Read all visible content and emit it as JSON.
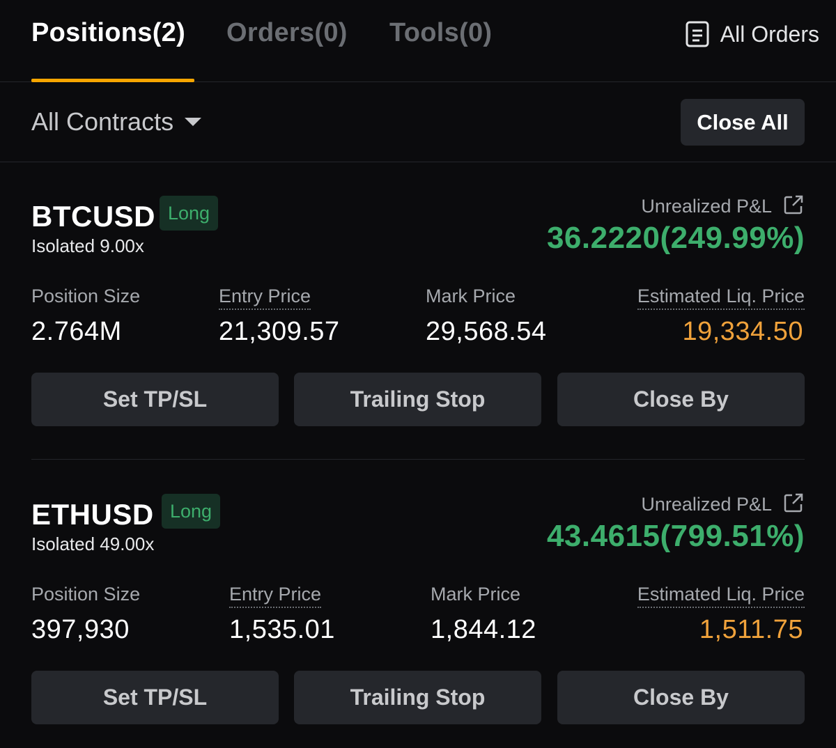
{
  "tabs": [
    {
      "label": "Positions(2)",
      "active": true
    },
    {
      "label": "Orders(0)",
      "active": false
    },
    {
      "label": "Tools(0)",
      "active": false
    }
  ],
  "all_orders": {
    "label": "All Orders",
    "icon": "document-icon"
  },
  "filter": {
    "label": "All Contracts",
    "icon": "caret-down-icon"
  },
  "close_all_label": "Close All",
  "positions": [
    {
      "symbol": "BTCUSD",
      "side": "Long",
      "leverage": "Isolated 9.00x",
      "pnl_label": "Unrealized P&L",
      "pnl_value": "36.2220(249.99%)",
      "stats": {
        "size_label": "Position Size",
        "size_value": "2.764M",
        "entry_label": "Entry Price",
        "entry_value": "21,309.57",
        "mark_label": "Mark Price",
        "mark_value": "29,568.54",
        "liq_label": "Estimated Liq. Price",
        "liq_value": "19,334.50"
      },
      "buttons": {
        "tpsl": "Set TP/SL",
        "trailing": "Trailing Stop",
        "close_by": "Close By"
      }
    },
    {
      "symbol": "ETHUSD",
      "side": "Long",
      "leverage": "Isolated 49.00x",
      "pnl_label": "Unrealized P&L",
      "pnl_value": "43.4615(799.51%)",
      "stats": {
        "size_label": "Position Size",
        "size_value": "397,930",
        "entry_label": "Entry Price",
        "entry_value": "1,535.01",
        "mark_label": "Mark Price",
        "mark_value": "1,844.12",
        "liq_label": "Estimated Liq. Price",
        "liq_value": "1,511.75"
      },
      "buttons": {
        "tpsl": "Set TP/SL",
        "trailing": "Trailing Stop",
        "close_by": "Close By"
      }
    }
  ],
  "colors": {
    "background": "#0b0b0d",
    "accent": "#f7a600",
    "profit": "#3dae6c",
    "liquidation": "#f0a23b",
    "button": "#25272c"
  }
}
